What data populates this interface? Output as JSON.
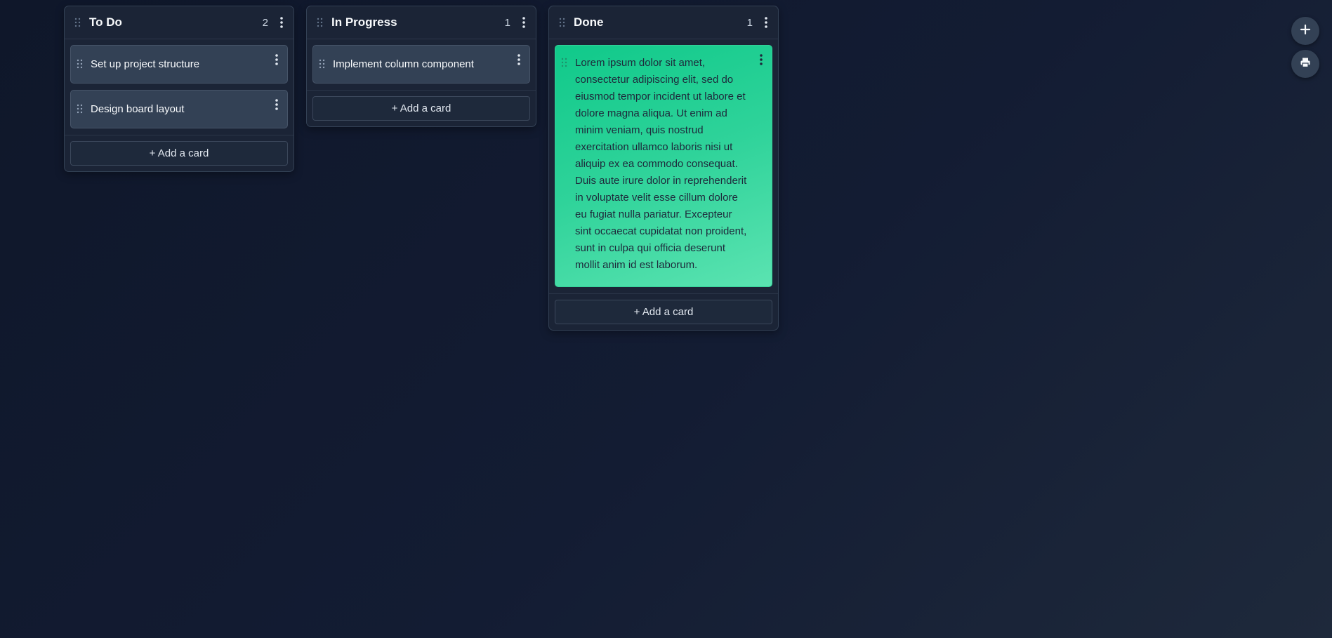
{
  "columns": [
    {
      "title": "To Do",
      "count": "2",
      "cards": [
        {
          "text": "Set up project structure"
        },
        {
          "text": "Design board layout"
        }
      ],
      "add_label": "+ Add a card"
    },
    {
      "title": "In Progress",
      "count": "1",
      "cards": [
        {
          "text": "Implement column component"
        }
      ],
      "add_label": "+ Add a card"
    },
    {
      "title": "Done",
      "count": "1",
      "cards": [
        {
          "text": "Lorem ipsum dolor sit amet, consectetur adipiscing elit, sed do eiusmod tempor incident ut labore et dolore magna aliqua. Ut enim ad minim veniam, quis nostrud exercitation ullamco laboris nisi ut aliquip ex ea commodo consequat. Duis aute irure dolor in reprehenderit in voluptate velit esse cillum dolore eu fugiat nulla pariatur. Excepteur sint occaecat cupidatat non proident, sunt in culpa qui officia deserunt mollit anim id est laborum.",
          "color": "#10c98a"
        }
      ],
      "add_label": "+ Add a card"
    }
  ],
  "toolbar": {
    "add_icon": "plus-icon",
    "print_icon": "printer-icon"
  },
  "colors": {
    "background": "#0f172a",
    "column": "#1b2436",
    "card": "#334155",
    "accent_card": "#10c98a"
  }
}
